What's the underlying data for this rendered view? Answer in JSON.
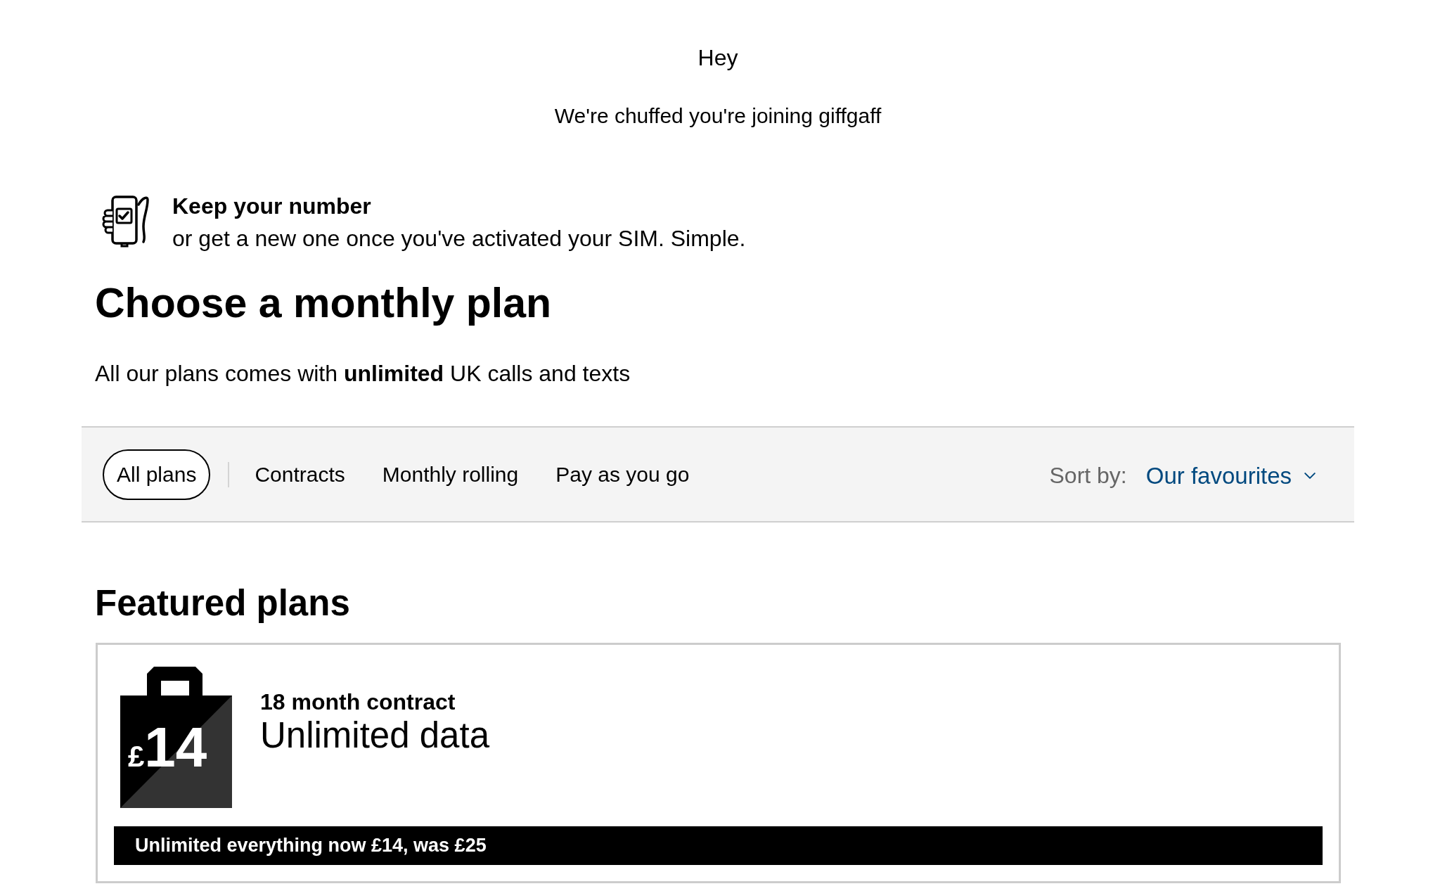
{
  "greeting": {
    "title": "Hey",
    "subtitle": "We're chuffed you're joining giffgaff"
  },
  "feature": {
    "title": "Keep your number",
    "description": "or get a new one once you've activated your SIM. Simple."
  },
  "page_heading": "Choose a monthly plan",
  "intro": "All our plans comes with **unlimited** UK calls and texts",
  "filter_bar": {
    "tabs": [
      {
        "label": "All plans",
        "selected": true
      },
      {
        "label": "Contracts",
        "selected": false
      },
      {
        "label": "Monthly rolling",
        "selected": false
      },
      {
        "label": "Pay as you go",
        "selected": false
      }
    ],
    "sort": {
      "label": "Sort by:",
      "value": "Our favourites"
    }
  },
  "featured": {
    "heading": "Featured plans",
    "plans": [
      {
        "currency": "£",
        "amount": "14",
        "term": "18 month contract",
        "name": "Unlimited data",
        "offer": "Unlimited everything now £14, was £25"
      }
    ]
  }
}
